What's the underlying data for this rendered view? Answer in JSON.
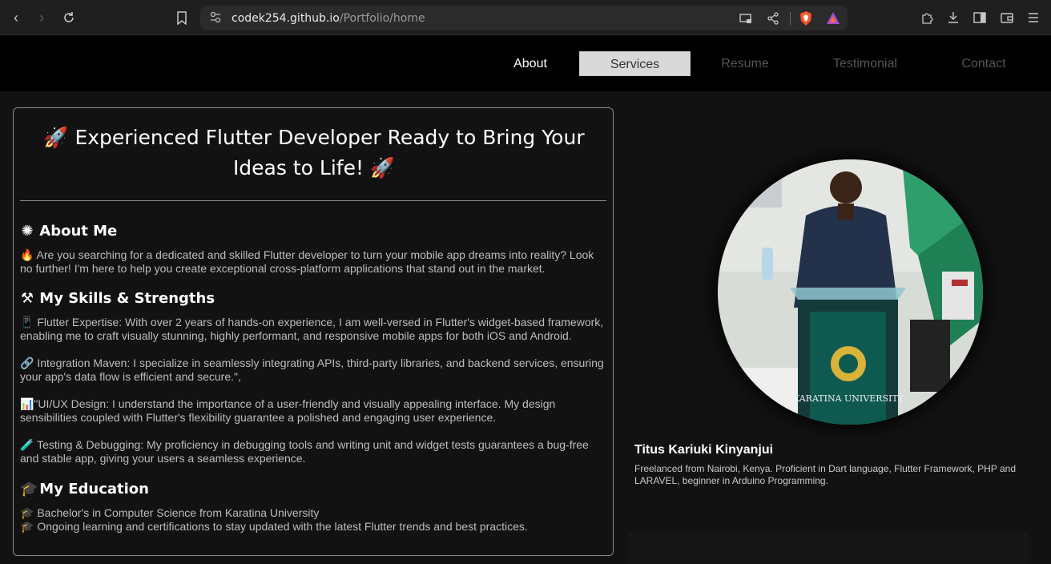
{
  "browser": {
    "url_host": "codek254.github.io",
    "url_path": "/Portfolio/home"
  },
  "nav": {
    "about": "About",
    "services": "Services",
    "resume": "Resume",
    "testimonial": "Testimonial",
    "contact": "Contact"
  },
  "main": {
    "headline": "🚀 Experienced Flutter Developer Ready to Bring Your Ideas to Life! 🚀",
    "about_title": "About Me",
    "about_text": "🔥 Are you searching for a dedicated and skilled Flutter developer to turn your mobile app dreams into reality? Look no further! I'm here to help you create exceptional cross-platform applications that stand out in the market.",
    "skills_title": "My Skills & Strengths",
    "skills": [
      "📱 Flutter Expertise: With over 2 years of hands-on experience, I am well-versed in Flutter's widget-based framework, enabling me to craft visually stunning, highly performant, and responsive mobile apps for both iOS and Android.",
      "🔗 Integration Maven: I specialize in seamlessly integrating APIs, third-party libraries, and backend services, ensuring your app's data flow is efficient and secure.\",",
      "📊\"UI/UX Design: I understand the importance of a user-friendly and visually appealing interface. My design sensibilities coupled with Flutter's flexibility guarantee a polished and engaging user experience.",
      "🧪 Testing & Debugging: My proficiency in debugging tools and writing unit and widget tests guarantees a bug-free and stable app, giving your users a seamless experience."
    ],
    "education_title": "My Education",
    "education": [
      "🎓 Bachelor's in Computer Science from Karatina University",
      "🎓 Ongoing learning and certifications to stay updated with the latest Flutter trends and best practices."
    ]
  },
  "profile": {
    "name": "Titus Kariuki Kinyanjui",
    "description": "Freelanced from Nairobi, Kenya. Proficient in Dart language, Flutter Framework, PHP and LARAVEL, beginner in Arduino Programming.",
    "photo_banner_text": "KARATINA UNIVERSITY"
  },
  "colors": {
    "accent_brave": "#fb542b",
    "nav_active_bg": "#d9d9d9",
    "page_bg": "#121212"
  }
}
